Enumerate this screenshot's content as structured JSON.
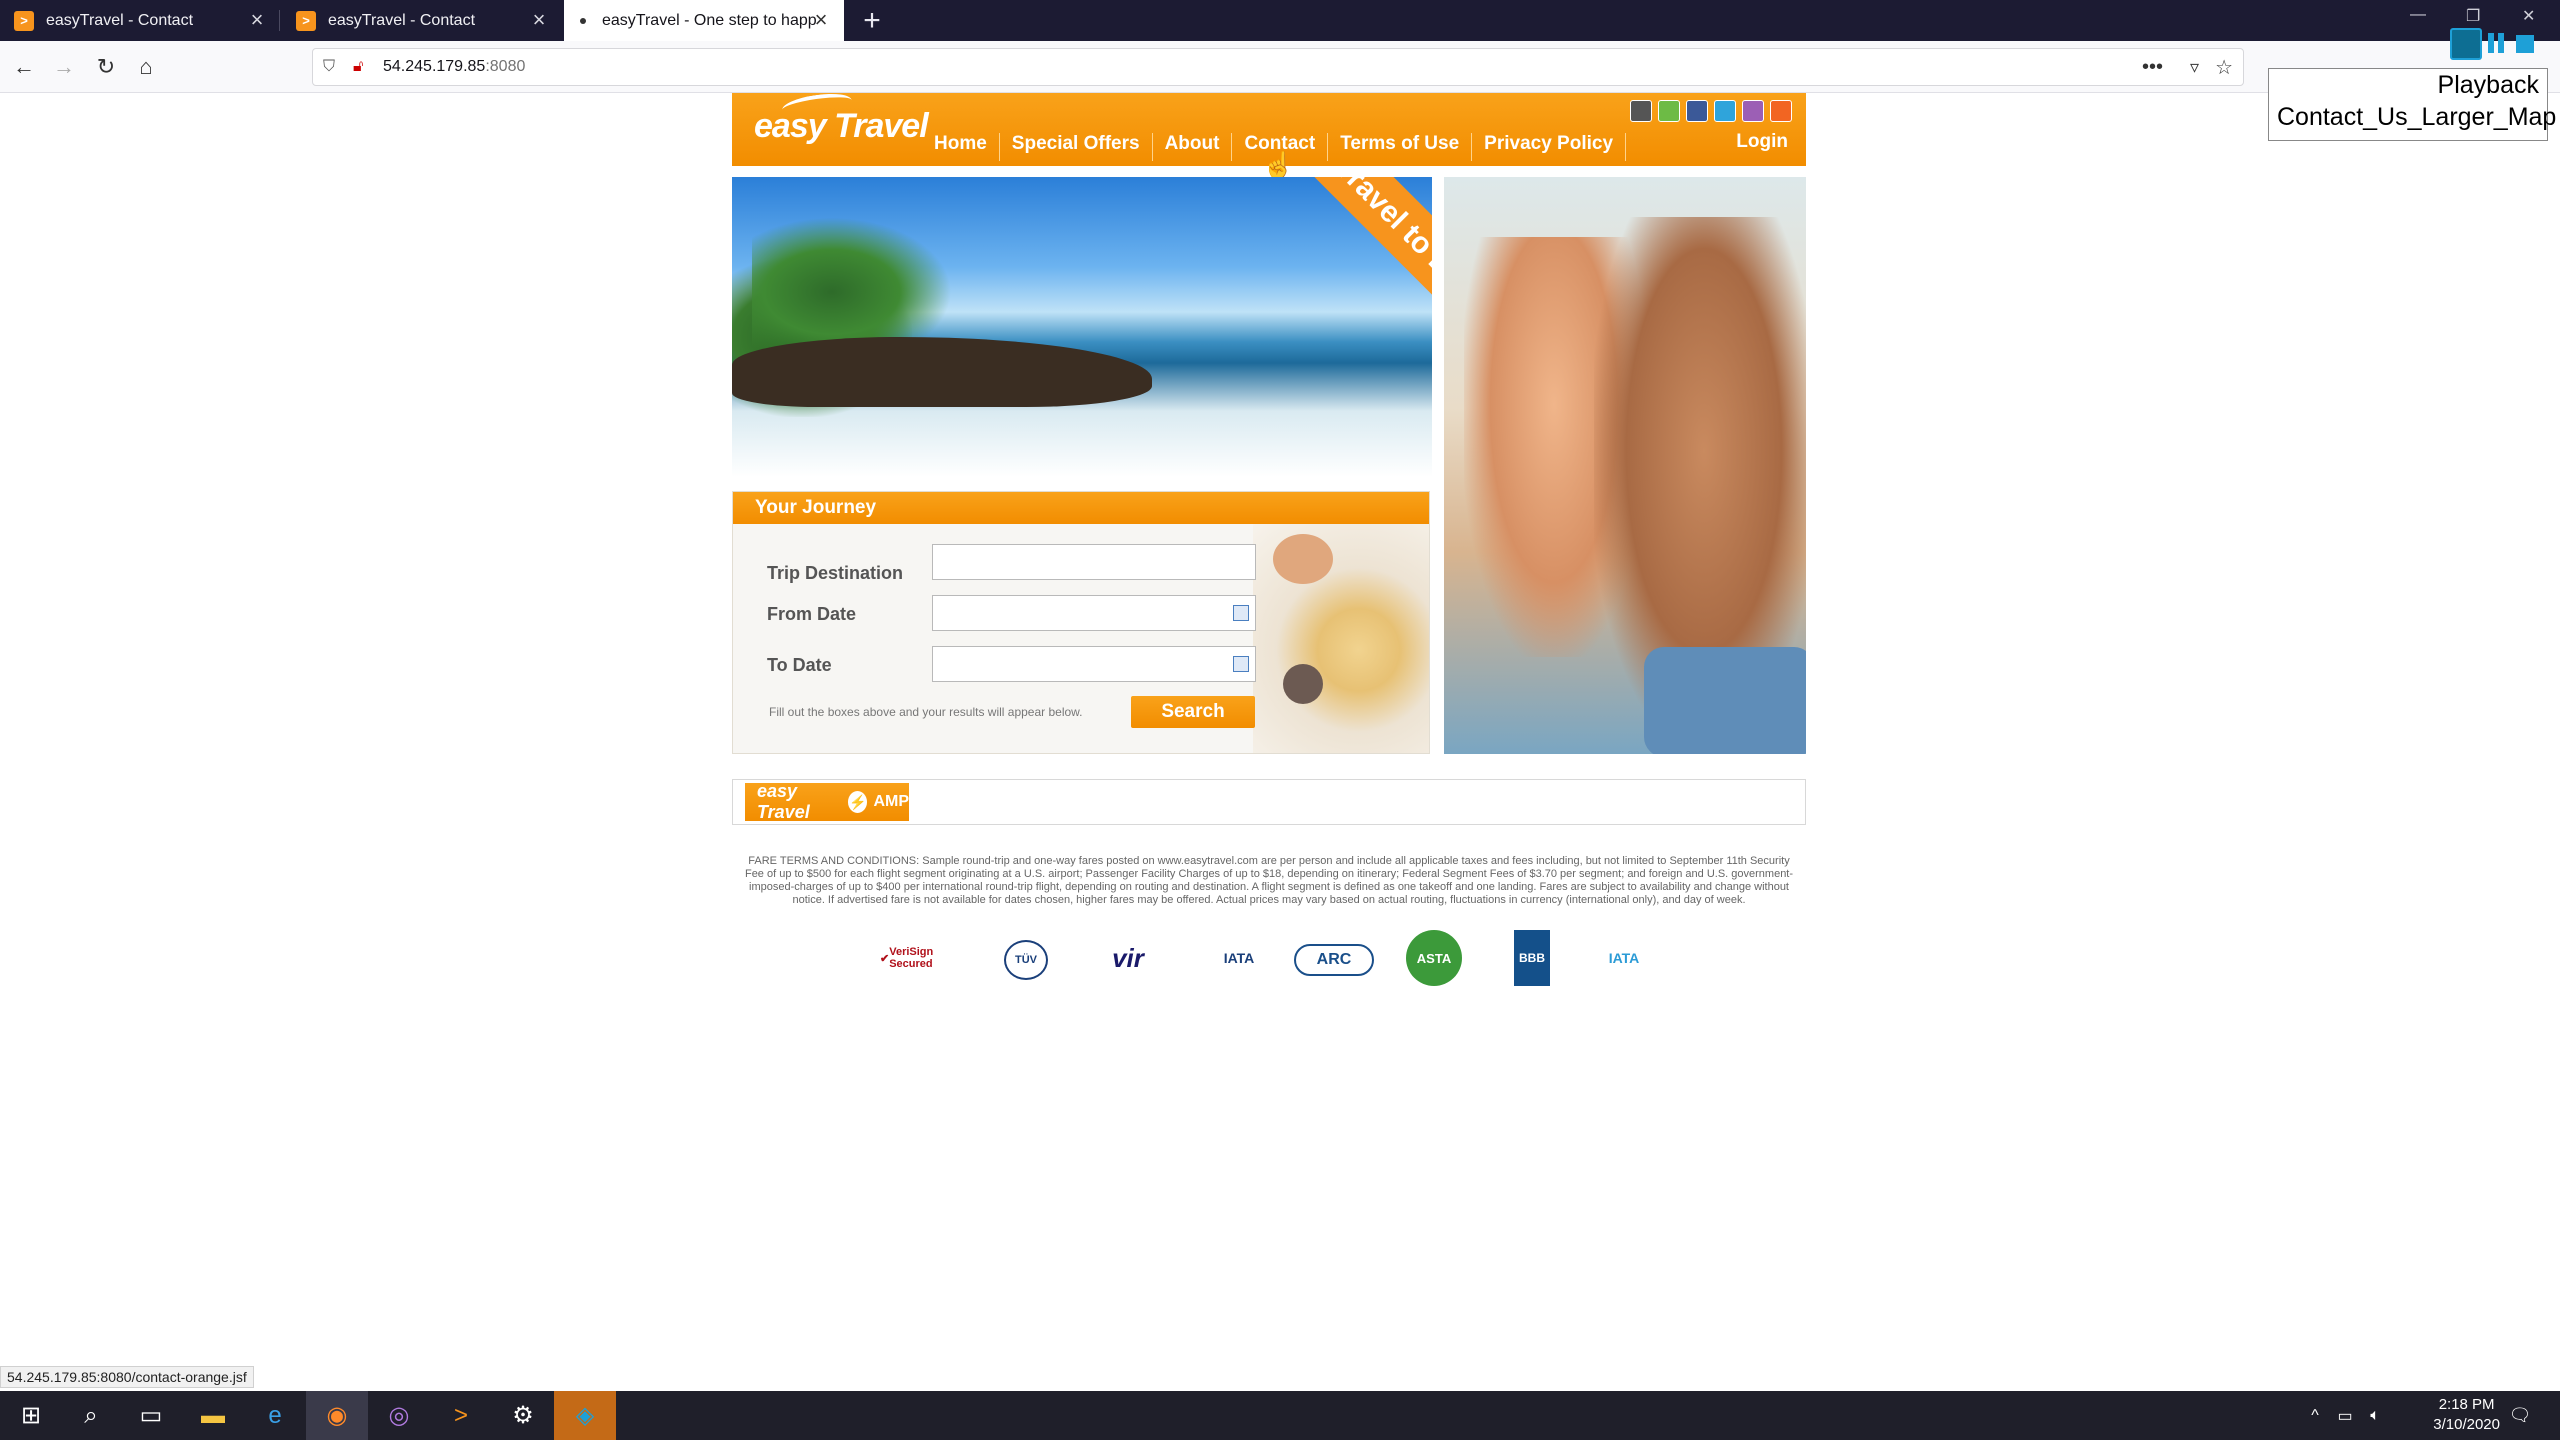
{
  "browser": {
    "tabs": [
      {
        "title": "easyTravel - Contact",
        "active": false
      },
      {
        "title": "easyTravel - Contact",
        "active": false
      },
      {
        "title": "easyTravel - One step to happ",
        "active": true
      }
    ],
    "url_host": "54.245.179.85",
    "url_port": ":8080",
    "status_url": "54.245.179.85:8080/contact-orange.jsf"
  },
  "playback": {
    "line1": "Playback",
    "line2": "Contact_Us_Larger_Map"
  },
  "site": {
    "logo": "easy Travel",
    "menu": [
      "Home",
      "Special Offers",
      "About",
      "Contact",
      "Terms of Use",
      "Privacy Policy"
    ],
    "login": "Login",
    "banner": "Travel to Beijing",
    "journey": {
      "title": "Your Journey",
      "trip_destination_label": "Trip Destination",
      "from_date_label": "From Date",
      "to_date_label": "To Date",
      "trip_destination_value": "",
      "from_date_value": "",
      "to_date_value": "",
      "hint": "Fill out the boxes above and your results will appear below.",
      "search_label": "Search"
    },
    "amp_logo": {
      "brand": "easy Travel",
      "suffix": "AMP"
    },
    "fare_terms": "FARE TERMS AND CONDITIONS: Sample round-trip and one-way fares posted on www.easytravel.com are per person and include all applicable taxes and fees including, but not limited to September 11th Security Fee of up to $500 for each flight segment originating at a U.S. airport; Passenger Facility Charges of up to $18, depending on itinerary; Federal Segment Fees of $3.70 per segment; and foreign and U.S. government-imposed-charges of up to $400 per international round-trip flight, depending on routing and destination. A flight segment is defined as one takeoff and one landing. Fares are subject to availability and change without notice. If advertised fare is not available for dates chosen, higher fares may be offered. Actual prices may vary based on actual routing, fluctuations in currency (international only), and day of week.",
    "badges": [
      "VeriSign Secured",
      "TÜV",
      "vir",
      "IATA",
      "ARC",
      "ASTA",
      "BBB",
      "IATA"
    ]
  },
  "taskbar": {
    "time": "2:18 PM",
    "date": "3/10/2020"
  },
  "colors": {
    "brand_orange": "#f7941d",
    "tabbar": "#1c1b33",
    "taskbar": "#1f1f2a"
  }
}
